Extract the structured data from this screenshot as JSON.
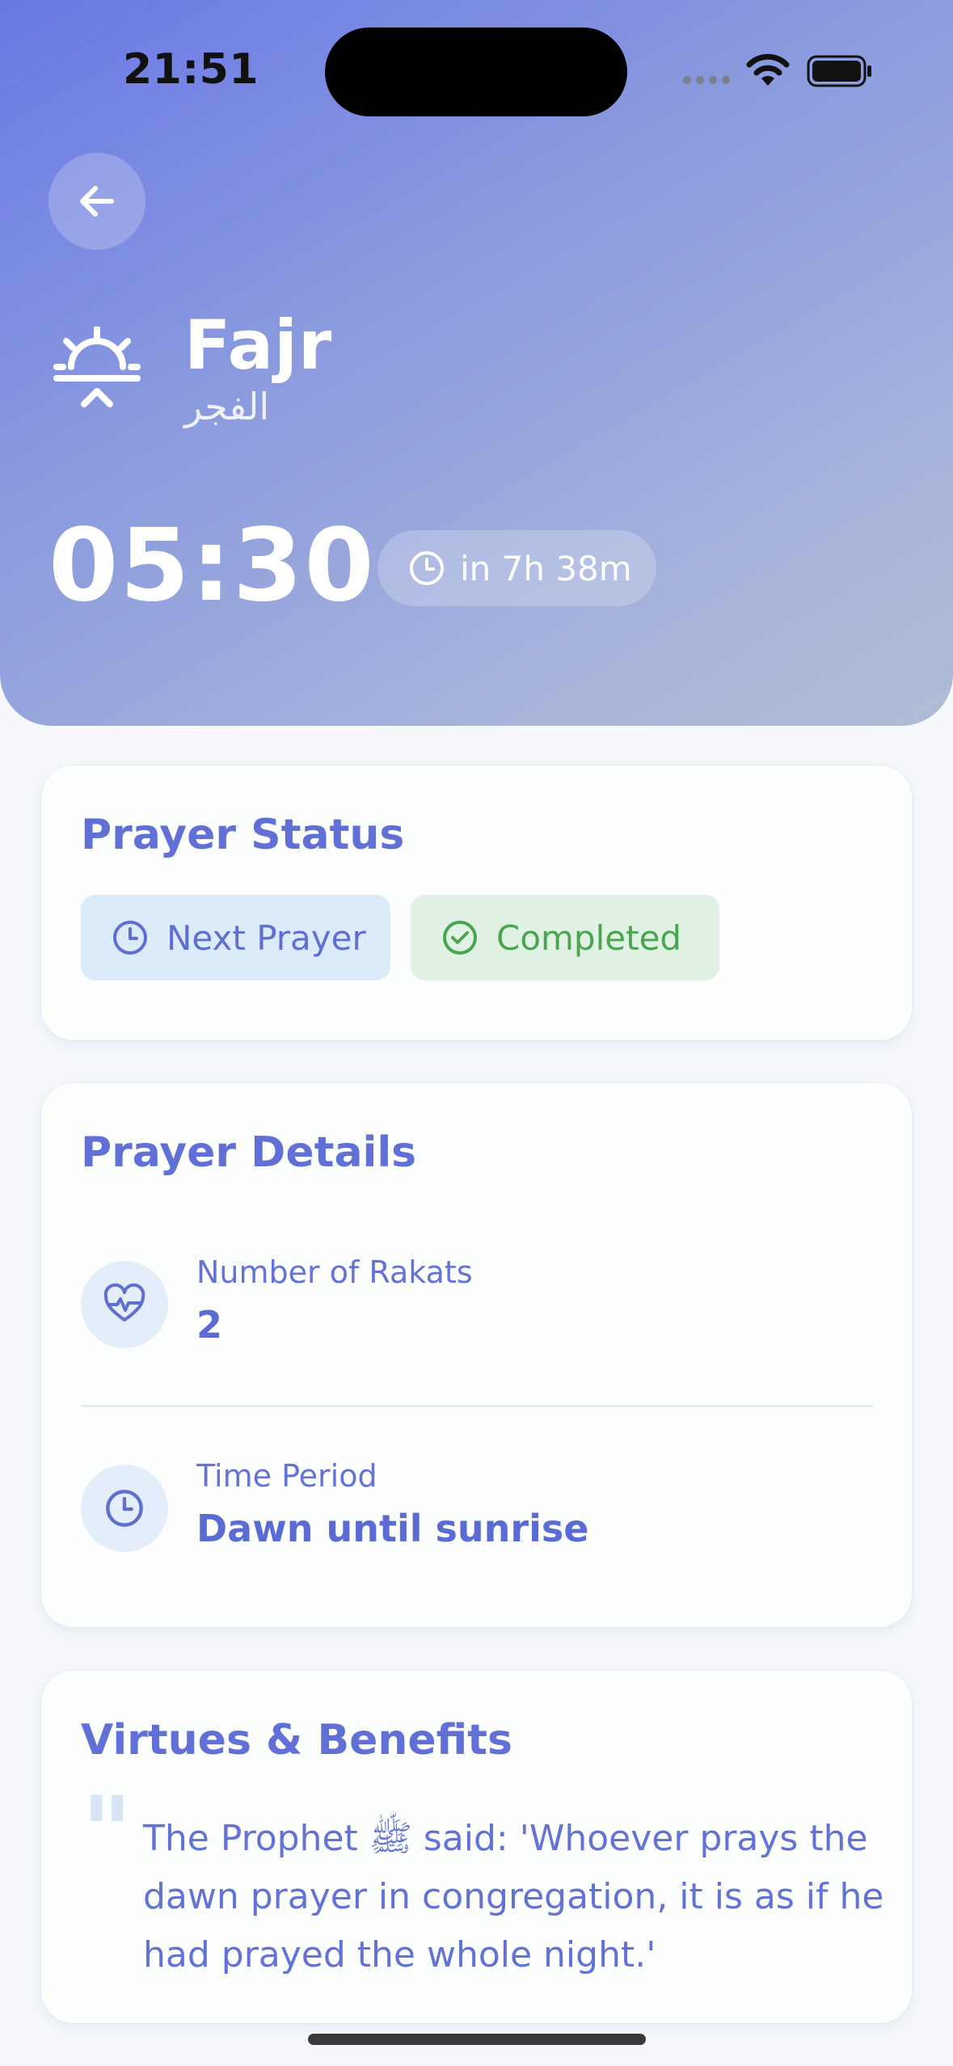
{
  "status_bar": {
    "time": "21:51"
  },
  "header": {
    "prayer_name": "Fajr",
    "prayer_name_arabic": "الفجر",
    "prayer_time": "05:30",
    "countdown": "in 7h 38m"
  },
  "status_card": {
    "title": "Prayer Status",
    "chips": [
      {
        "label": "Next Prayer",
        "icon": "clock-icon",
        "color": "#5f6fd0"
      },
      {
        "label": "Completed",
        "icon": "check-circle-icon",
        "color": "#4aa552"
      }
    ]
  },
  "details_card": {
    "title": "Prayer Details",
    "items": [
      {
        "label": "Number of Rakats",
        "value": "2",
        "icon": "heart-pulse-icon"
      },
      {
        "label": "Time Period",
        "value": "Dawn until sunrise",
        "icon": "clock-icon"
      }
    ]
  },
  "virtues_card": {
    "title": "Virtues & Benefits",
    "quote": "The Prophet ﷺ said: 'Whoever prays the dawn prayer in congregation, it is as if he had prayed the whole night.'"
  },
  "colors": {
    "accent": "#6170d6",
    "hero_gradient_start": "#6a78e6",
    "hero_gradient_end": "#b0bcd6",
    "success": "#4aa552"
  }
}
